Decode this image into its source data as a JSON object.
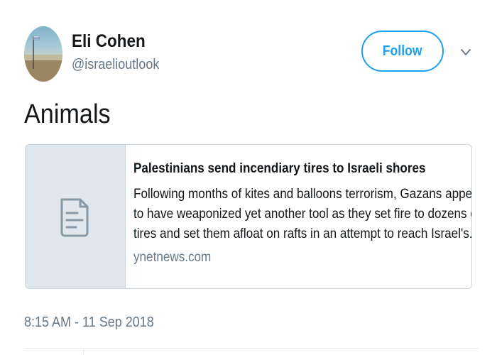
{
  "author": {
    "name": "Eli Cohen",
    "handle": "@israelioutlook",
    "avatar_icon": "profile-photo"
  },
  "follow_button": {
    "label": "Follow",
    "color": "#1da1f2"
  },
  "menu_icon": "chevron-down-icon",
  "tweet": {
    "text": "Animals",
    "timestamp": "8:15 AM - 11 Sep 2018"
  },
  "card": {
    "thumbnail_icon": "document-icon",
    "title": "Palestinians send incendiary tires to Israeli shores",
    "description_lines": [
      "Following months of kites and balloons terrorism, Gazans appear",
      "to have weaponized yet another tool as they set fire to dozens of",
      "tires and set them afloat on rafts in an attempt to reach Israel's..."
    ],
    "domain": "ynetnews.com"
  },
  "colors": {
    "text_primary": "#14171a",
    "text_secondary": "#657786",
    "card_border": "#ccd6dd",
    "thumb_background": "#e1e8ed"
  }
}
